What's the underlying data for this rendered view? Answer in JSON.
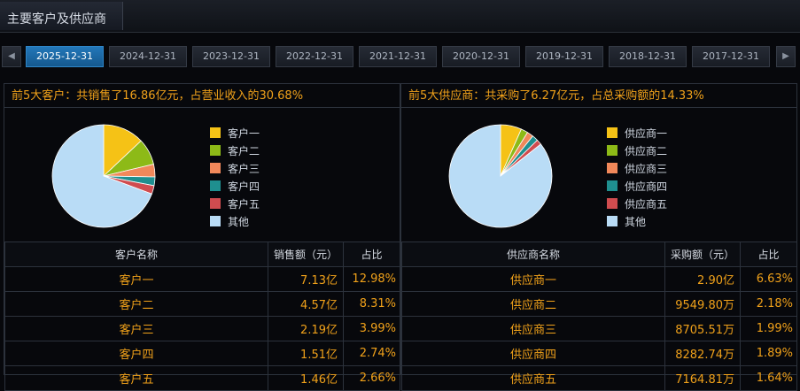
{
  "header": {
    "title": "主要客户及供应商"
  },
  "nav": {
    "prev_icon": "◀",
    "next_icon": "▶"
  },
  "date_tabs": [
    {
      "label": "2025-12-31",
      "active": true
    },
    {
      "label": "2024-12-31",
      "active": false
    },
    {
      "label": "2023-12-31",
      "active": false
    },
    {
      "label": "2022-12-31",
      "active": false
    },
    {
      "label": "2021-12-31",
      "active": false
    },
    {
      "label": "2020-12-31",
      "active": false
    },
    {
      "label": "2019-12-31",
      "active": false
    },
    {
      "label": "2018-12-31",
      "active": false
    },
    {
      "label": "2017-12-31",
      "active": false
    }
  ],
  "colors": {
    "accent": "#f0a11a",
    "active_tab": "#1f6fad",
    "slice_1": "#f5c216",
    "slice_2": "#8dba17",
    "slice_3": "#f1885a",
    "slice_4": "#1f8f8f",
    "slice_5": "#d04c4f",
    "slice_other": "#b9dcf6"
  },
  "customers": {
    "summary": "前5大客户：共销售了16.86亿元，占营业收入的30.68%",
    "legend": [
      "客户一",
      "客户二",
      "客户三",
      "客户四",
      "客户五",
      "其他"
    ],
    "columns": [
      "客户名称",
      "销售额（元）",
      "占比"
    ],
    "rows": [
      {
        "name": "客户一",
        "amount": "7.13亿",
        "share": "12.98%"
      },
      {
        "name": "客户二",
        "amount": "4.57亿",
        "share": "8.31%"
      },
      {
        "name": "客户三",
        "amount": "2.19亿",
        "share": "3.99%"
      },
      {
        "name": "客户四",
        "amount": "1.51亿",
        "share": "2.74%"
      },
      {
        "name": "客户五",
        "amount": "1.46亿",
        "share": "2.66%"
      }
    ]
  },
  "suppliers": {
    "summary": "前5大供应商：共采购了6.27亿元，占总采购额的14.33%",
    "legend": [
      "供应商一",
      "供应商二",
      "供应商三",
      "供应商四",
      "供应商五",
      "其他"
    ],
    "columns": [
      "供应商名称",
      "采购额（元）",
      "占比"
    ],
    "rows": [
      {
        "name": "供应商一",
        "amount": "2.90亿",
        "share": "6.63%"
      },
      {
        "name": "供应商二",
        "amount": "9549.80万",
        "share": "2.18%"
      },
      {
        "name": "供应商三",
        "amount": "8705.51万",
        "share": "1.99%"
      },
      {
        "name": "供应商四",
        "amount": "8282.74万",
        "share": "1.89%"
      },
      {
        "name": "供应商五",
        "amount": "7164.81万",
        "share": "1.64%"
      }
    ]
  },
  "chart_data": [
    {
      "type": "pie",
      "categories": [
        "客户一",
        "客户二",
        "客户三",
        "客户四",
        "客户五",
        "其他"
      ],
      "values": [
        12.98,
        8.31,
        3.99,
        2.74,
        2.66,
        69.32
      ]
    },
    {
      "type": "pie",
      "categories": [
        "供应商一",
        "供应商二",
        "供应商三",
        "供应商四",
        "供应商五",
        "其他"
      ],
      "values": [
        6.63,
        2.18,
        1.99,
        1.89,
        1.64,
        85.67
      ]
    }
  ]
}
